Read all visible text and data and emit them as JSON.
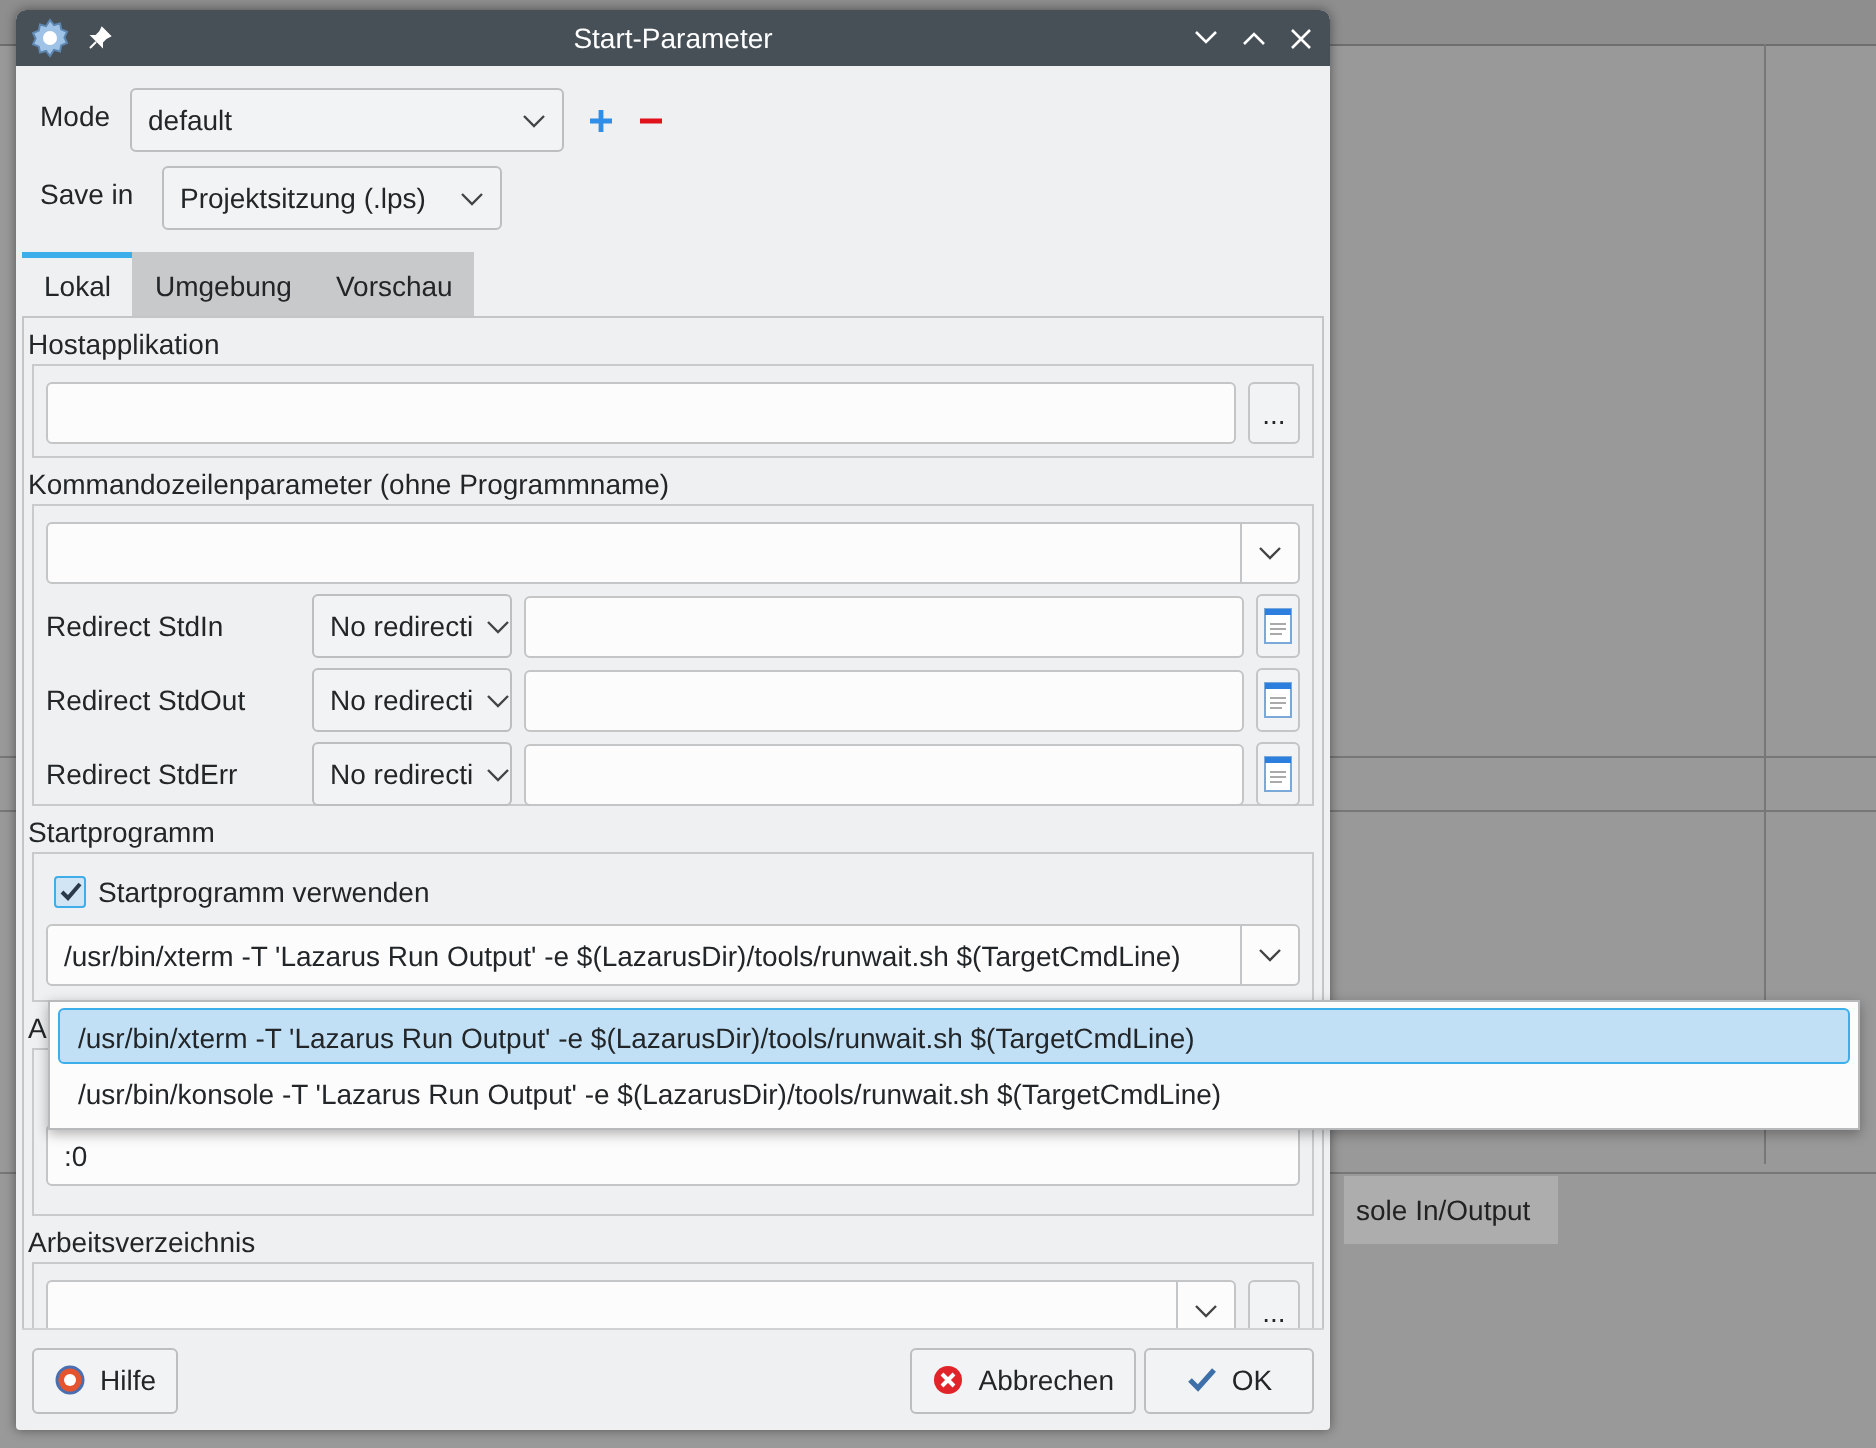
{
  "background": {
    "bottom_tab": "sole In/Output"
  },
  "window": {
    "title": "Start-Parameter"
  },
  "mode": {
    "label": "Mode",
    "value": "default"
  },
  "save_in": {
    "label": "Save in",
    "value": "Projektsitzung (.lps)"
  },
  "tabs": [
    {
      "label": "Lokal",
      "selected": true
    },
    {
      "label": "Umgebung",
      "selected": false
    },
    {
      "label": "Vorschau",
      "selected": false
    }
  ],
  "host_application": {
    "label": "Hostapplikation",
    "browse": "..."
  },
  "command_line": {
    "label": "Kommandozeilenparameter (ohne Programmname)"
  },
  "redirects": [
    {
      "label": "Redirect StdIn",
      "mode": "No redirecti"
    },
    {
      "label": "Redirect StdOut",
      "mode": "No redirecti"
    },
    {
      "label": "Redirect StdErr",
      "mode": "No redirecti"
    }
  ],
  "launcher": {
    "label": "Startprogramm",
    "checkbox": {
      "label": "Startprogramm verwenden",
      "checked": true
    },
    "value": "/usr/bin/xterm -T 'Lazarus Run Output' -e $(LazarusDir)/tools/runwait.sh $(TargetCmdLine)",
    "options": [
      {
        "text": "/usr/bin/xterm -T 'Lazarus Run Output' -e $(LazarusDir)/tools/runwait.sh $(TargetCmdLine)",
        "selected": true
      },
      {
        "text": "/usr/bin/konsole -T 'Lazarus Run Output' -e $(LazarusDir)/tools/runwait.sh $(TargetCmdLine)",
        "selected": false
      }
    ]
  },
  "display": {
    "label": "A",
    "value": ":0"
  },
  "working_directory": {
    "label": "Arbeitsverzeichnis",
    "browse": "..."
  },
  "buttons": [
    {
      "kind": "help",
      "label": "Hilfe"
    },
    {
      "kind": "cancel",
      "label": "Abbrechen"
    },
    {
      "kind": "ok",
      "label": "OK"
    }
  ]
}
